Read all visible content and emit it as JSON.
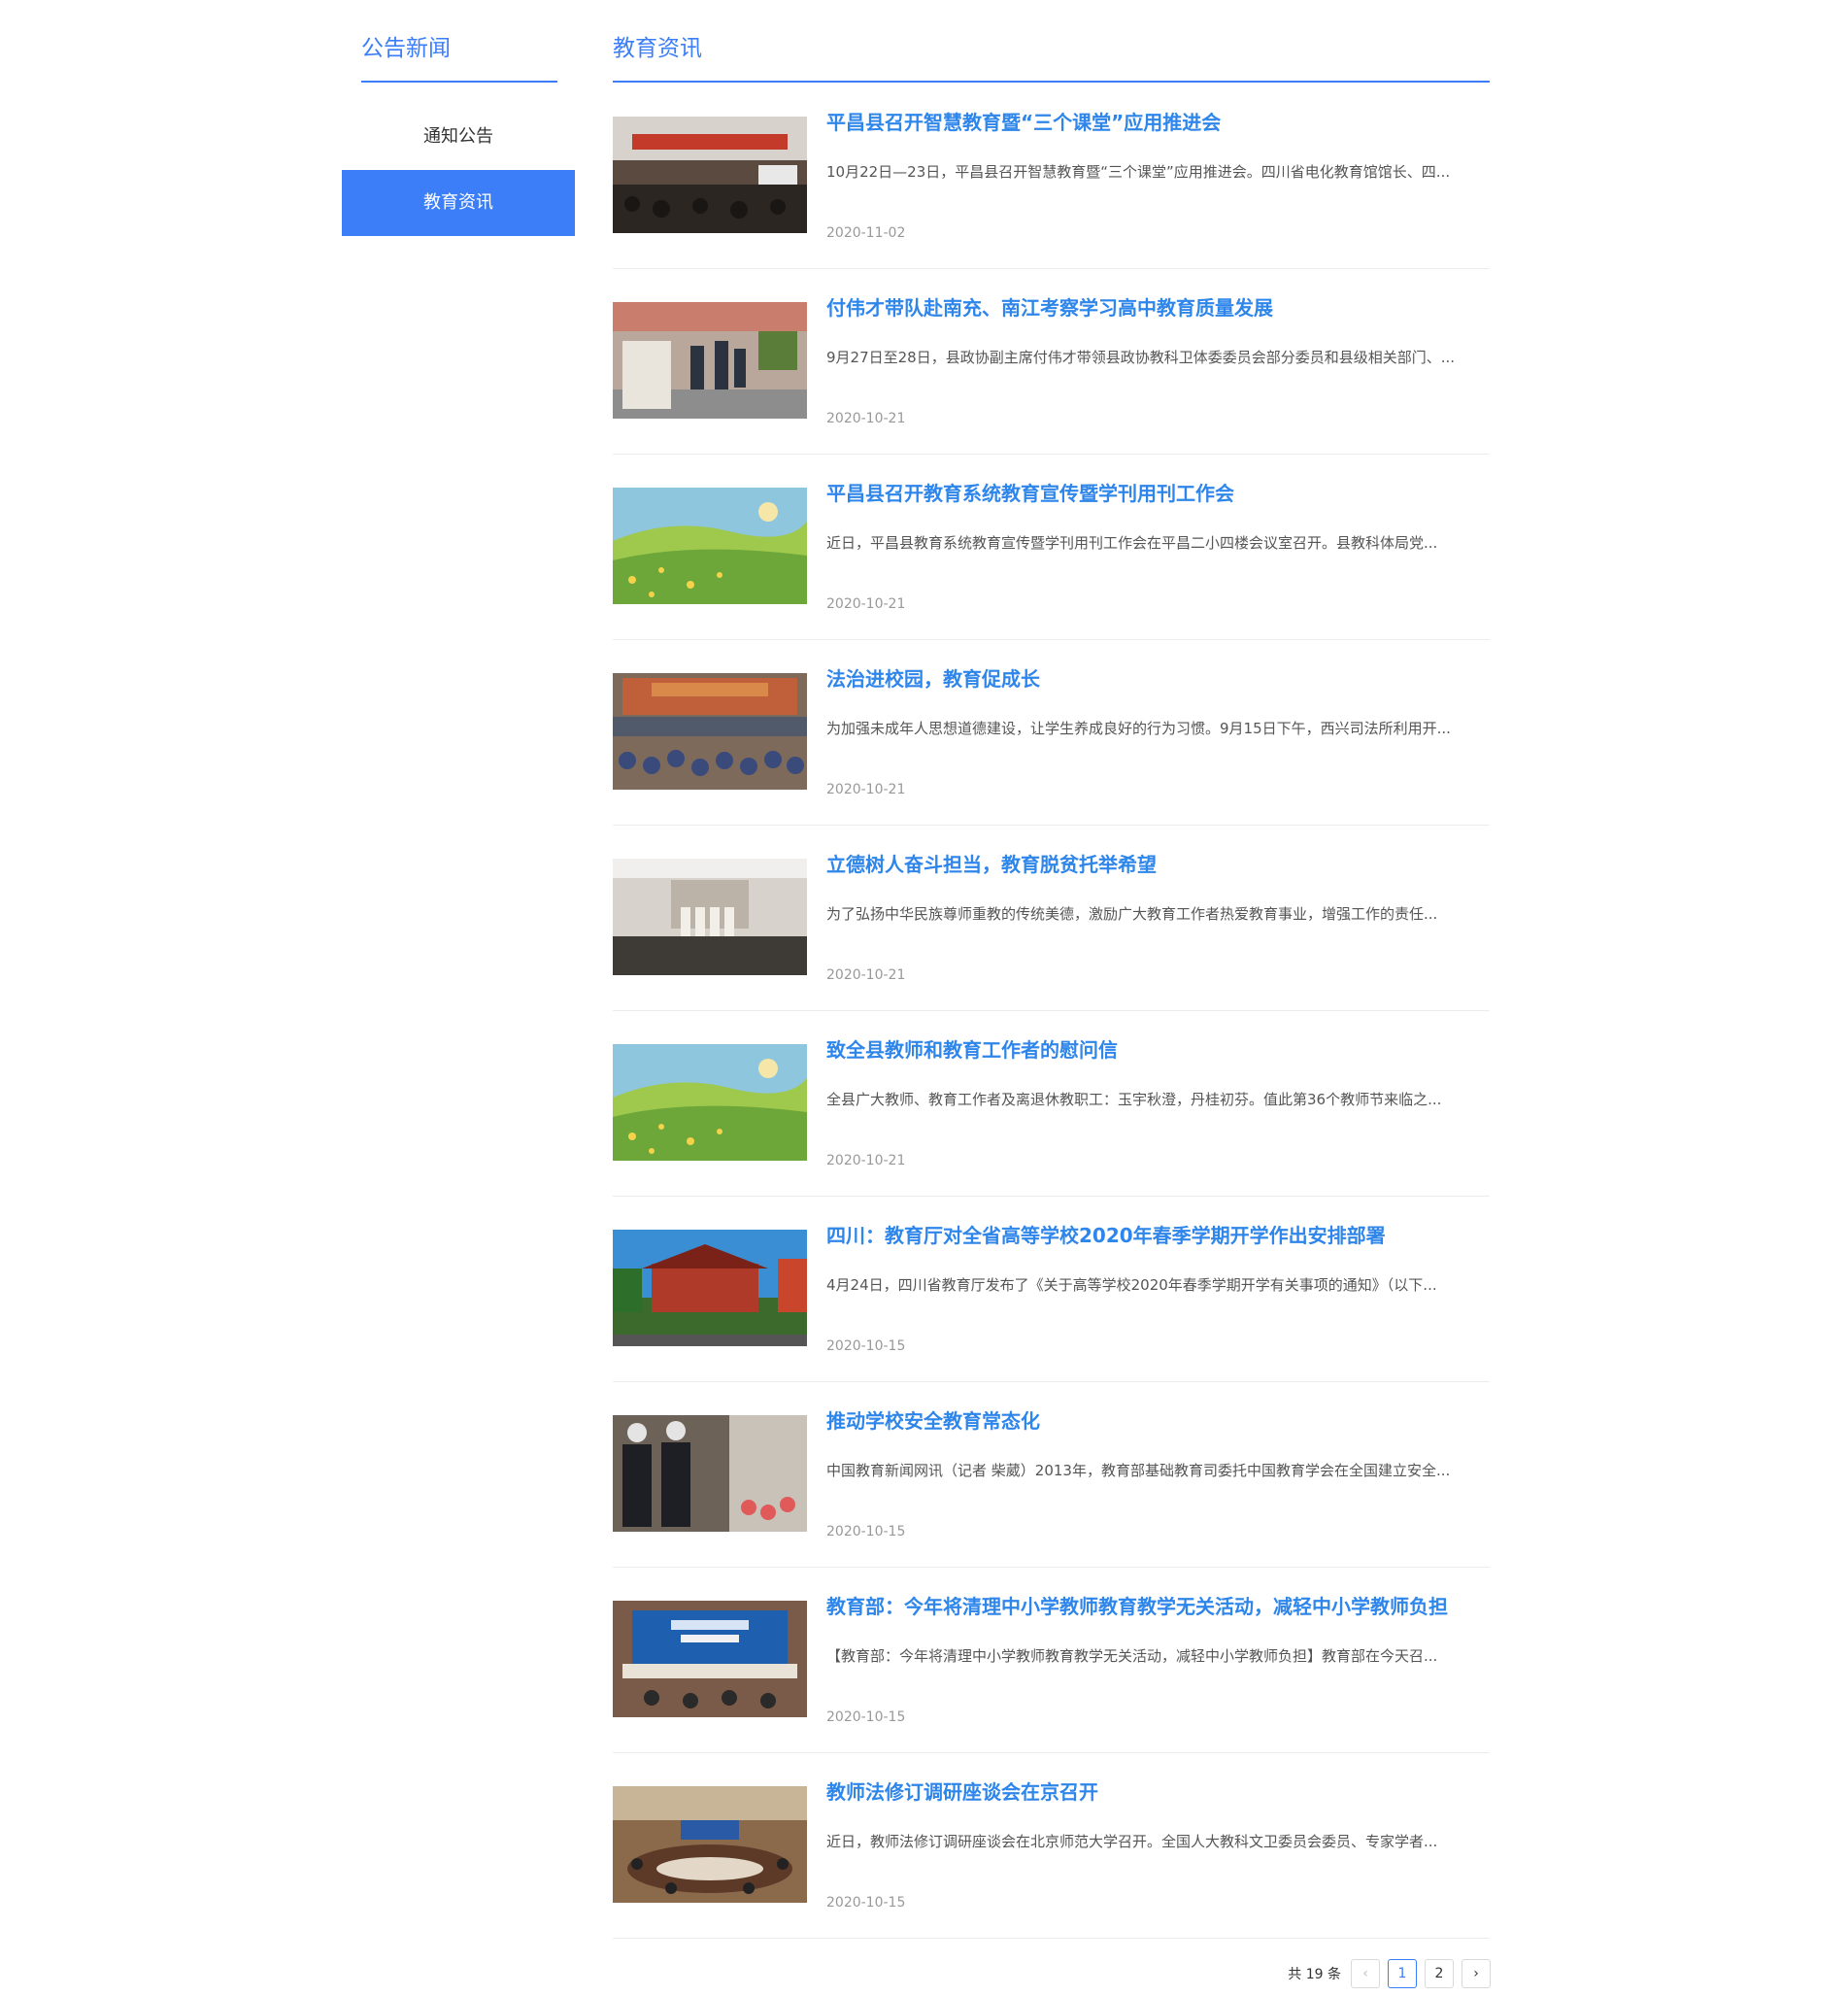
{
  "sidebar": {
    "title": "公告新闻",
    "items": [
      {
        "label": "通知公告",
        "active": false
      },
      {
        "label": "教育资讯",
        "active": true
      }
    ]
  },
  "main": {
    "title": "教育资讯",
    "news": [
      {
        "title": "平昌县召开智慧教育暨“三个课堂”应用推进会",
        "summary": "10月22日—23日，平昌县召开智慧教育暨“三个课堂”应用推进会。四川省电化教育馆馆长、四...",
        "date": "2020-11-02",
        "image": "conference-hall-photo"
      },
      {
        "title": "付伟才带队赴南充、南江考察学习高中教育质量发展",
        "summary": "9月27日至28日，县政协副主席付伟才带领县政协教科卫体委委员会部分委员和县级相关部门、...",
        "date": "2020-10-21",
        "image": "school-visit-photo"
      },
      {
        "title": "平昌县召开教育系统教育宣传暨学刊用刊工作会",
        "summary": "近日，平昌县教育系统教育宣传暨学刊用刊工作会在平昌二小四楼会议室召开。县教科体局党...",
        "date": "2020-10-21",
        "image": "green-meadow-illustration"
      },
      {
        "title": "法治进校园，教育促成长",
        "summary": "为加强未成年人思想道德建设，让学生养成良好的行为习惯。9月15日下午，西兴司法所利用开...",
        "date": "2020-10-21",
        "image": "school-assembly-photo"
      },
      {
        "title": "立德树人奋斗担当，教育脱贫托举希望",
        "summary": "为了弘扬中华民族尊师重教的传统美德，激励广大教育工作者热爱教育事业，增强工作的责任...",
        "date": "2020-10-21",
        "image": "award-ceremony-photo"
      },
      {
        "title": "致全县教师和教育工作者的慰问信",
        "summary": "全县广大教师、教育工作者及离退休教职工：玉宇秋澄，丹桂初芬。值此第36个教师节来临之...",
        "date": "2020-10-21",
        "image": "green-meadow-illustration"
      },
      {
        "title": "四川：教育厅对全省高等学校2020年春季学期开学作出安排部署",
        "summary": "4月24日，四川省教育厅发布了《关于高等学校2020年春季学期开学有关事项的通知》（以下...",
        "date": "2020-10-15",
        "image": "university-building-photo"
      },
      {
        "title": "推动学校安全教育常态化",
        "summary": "中国教育新闻网讯（记者 柴葳）2013年，教育部基础教育司委托中国教育学会在全国建立安全...",
        "date": "2020-10-15",
        "image": "security-guards-photo"
      },
      {
        "title": "教育部：今年将清理中小学教师教育教学无关活动，减轻中小学教师负担",
        "summary": "【教育部：今年将清理中小学教师教育教学无关活动，减轻中小学教师负担】教育部在今天召...",
        "date": "2020-10-15",
        "image": "press-conference-photo"
      },
      {
        "title": "教师法修订调研座谈会在京召开",
        "summary": "近日，教师法修订调研座谈会在北京师范大学召开。全国人大教科文卫委员会委员、专家学者...",
        "date": "2020-10-15",
        "image": "meeting-room-photo"
      }
    ]
  },
  "pagination": {
    "total_text": "共 19 条",
    "prev": "‹",
    "pages": [
      "1",
      "2"
    ],
    "current": "1",
    "next": "›"
  },
  "colors": {
    "accent": "#3b7ef8",
    "title_blue": "#2f86ea",
    "date_gray": "#999999"
  }
}
